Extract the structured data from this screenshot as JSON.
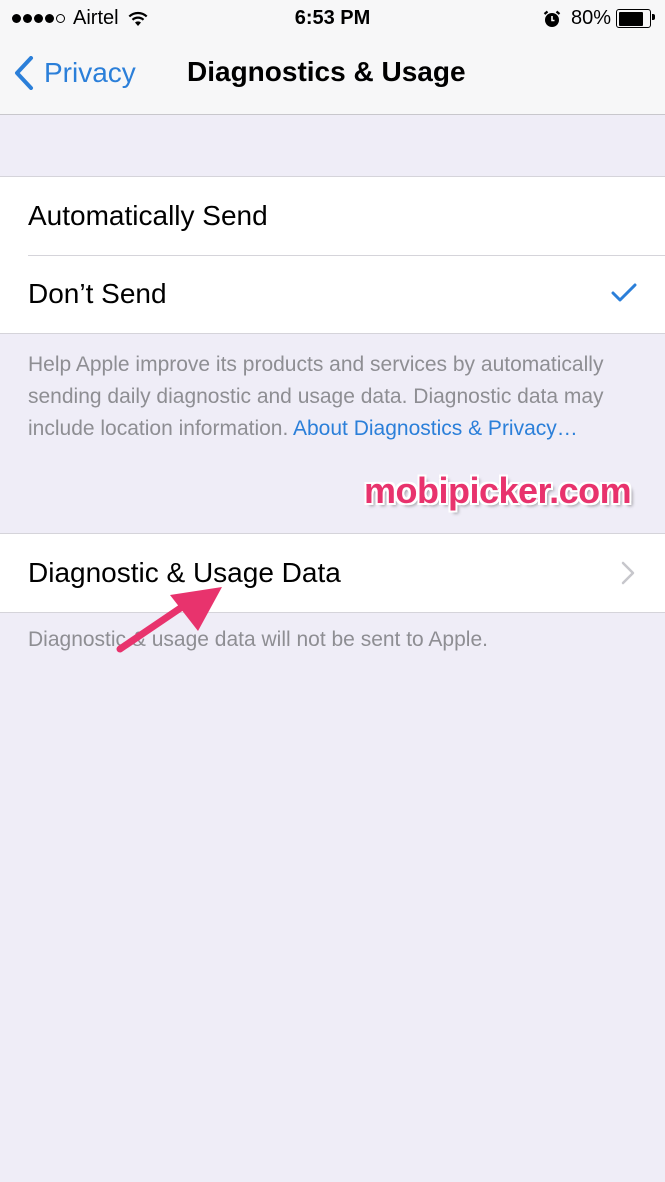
{
  "status_bar": {
    "signal_filled": 4,
    "signal_total": 5,
    "carrier": "Airtel",
    "time": "6:53 PM",
    "battery_percent_label": "80%",
    "battery_level": 0.8,
    "icons": [
      "signal-dots-icon",
      "wifi-icon",
      "alarm-icon",
      "battery-icon"
    ]
  },
  "nav": {
    "back_label": "Privacy",
    "title": "Diagnostics & Usage"
  },
  "send_options": {
    "items": [
      {
        "label": "Automatically Send",
        "selected": false
      },
      {
        "label": "Don’t Send",
        "selected": true
      }
    ],
    "footer_text": "Help Apple improve its products and services by automatically sending daily diagnostic and usage data. Diagnostic data may include location information. ",
    "footer_link": "About Diagnostics & Privacy…"
  },
  "data_section": {
    "item_label": "Diagnostic & Usage Data",
    "footer_text": "Diagnostic & usage data will not be sent to Apple."
  },
  "watermark": "mobipicker.com",
  "colors": {
    "accent": "#2b7fd9",
    "background": "#efedf7",
    "footer_text": "#8e8e93",
    "watermark": "#e8336d"
  }
}
